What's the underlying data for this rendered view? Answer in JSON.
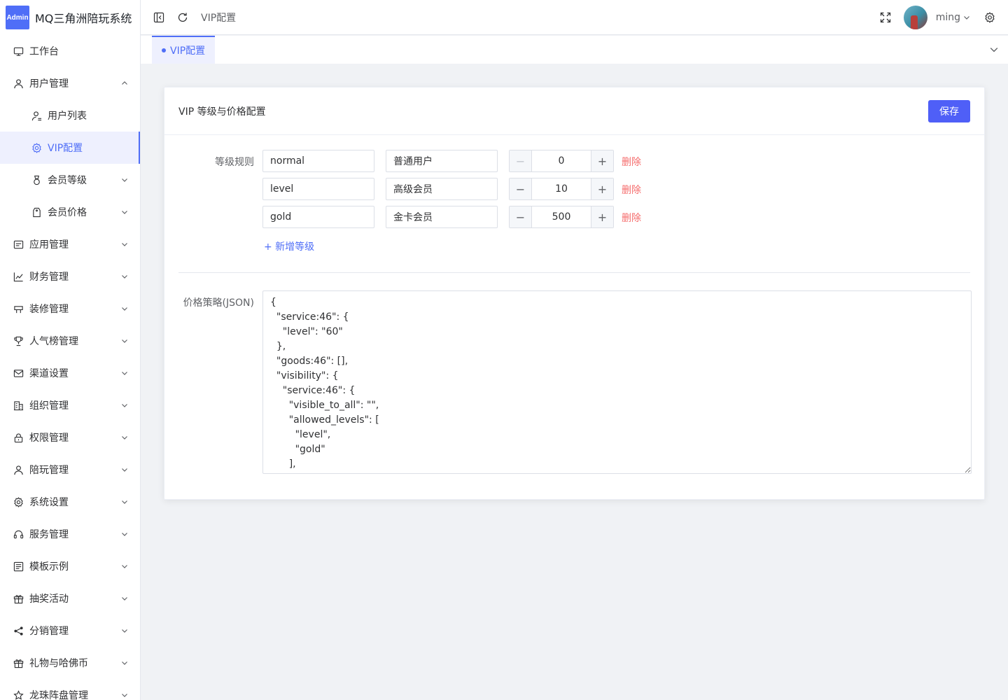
{
  "app": {
    "logo_text": "Admin",
    "title": "MQ三角洲陪玩系统"
  },
  "sidebar": {
    "items": [
      {
        "label": "工作台",
        "icon": "monitor-icon"
      },
      {
        "label": "用户管理",
        "icon": "user-icon",
        "expanded": true
      },
      {
        "label": "用户列表",
        "icon": "user-list-icon"
      },
      {
        "label": "VIP配置",
        "icon": "gear-icon",
        "active": true
      },
      {
        "label": "会员等级",
        "icon": "medal-icon"
      },
      {
        "label": "会员价格",
        "icon": "price-tag-icon"
      },
      {
        "label": "应用管理",
        "icon": "app-icon"
      },
      {
        "label": "财务管理",
        "icon": "chart-icon"
      },
      {
        "label": "装修管理",
        "icon": "decorate-icon"
      },
      {
        "label": "人气榜管理",
        "icon": "trophy-icon"
      },
      {
        "label": "渠道设置",
        "icon": "mail-icon"
      },
      {
        "label": "组织管理",
        "icon": "building-icon"
      },
      {
        "label": "权限管理",
        "icon": "lock-icon"
      },
      {
        "label": "陪玩管理",
        "icon": "user-icon"
      },
      {
        "label": "系统设置",
        "icon": "gear-icon"
      },
      {
        "label": "服务管理",
        "icon": "headset-icon"
      },
      {
        "label": "模板示例",
        "icon": "template-icon"
      },
      {
        "label": "抽奖活动",
        "icon": "gift-icon"
      },
      {
        "label": "分销管理",
        "icon": "share-icon"
      },
      {
        "label": "礼物与哈佛币",
        "icon": "gift-icon"
      },
      {
        "label": "龙珠阵盘管理",
        "icon": "star-icon"
      }
    ]
  },
  "header": {
    "breadcrumb": "VIP配置",
    "user_name": "ming"
  },
  "tabs": [
    {
      "label": "VIP配置",
      "active": true
    }
  ],
  "card": {
    "title": "VIP 等级与价格配置",
    "save_label": "保存",
    "levels_label": "等级规则",
    "levels": [
      {
        "key": "normal",
        "name": "普通用户",
        "value": "0",
        "delete_label": "删除"
      },
      {
        "key": "level",
        "name": "高级会员",
        "value": "10",
        "delete_label": "删除"
      },
      {
        "key": "gold",
        "name": "金卡会员",
        "value": "500",
        "delete_label": "删除"
      }
    ],
    "add_level_label": "+ 新增等级",
    "price_label": "价格策略(JSON)",
    "price_json": "{\n  \"service:46\": {\n    \"level\": \"60\"\n  },\n  \"goods:46\": [],\n  \"visibility\": {\n    \"service:46\": {\n      \"visible_to_all\": \"\",\n      \"allowed_levels\": [\n        \"level\",\n        \"gold\"\n      ],\n      \"hidden_levels\": []\n    }\n  }\n}"
  },
  "colors": {
    "accent": "#4f6ef7",
    "danger": "#f56c6c"
  }
}
